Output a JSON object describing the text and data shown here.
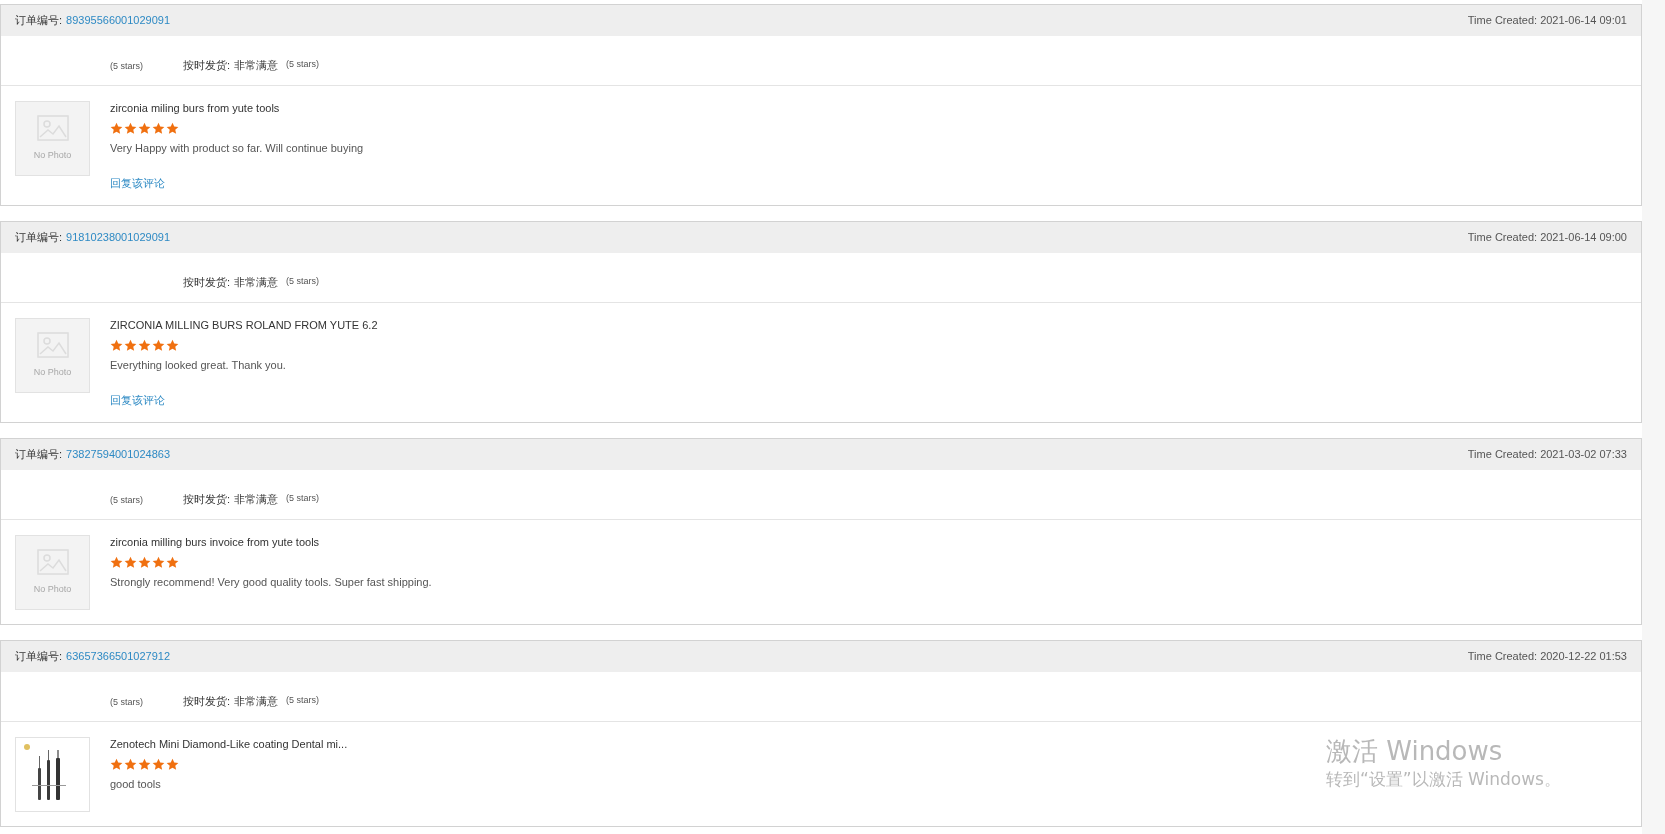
{
  "reviews": [
    {
      "order_label": "订单编号:",
      "order_no": "89395566001029091",
      "time": "Time Created: 2021-06-14 09:01",
      "service_note": "(5 stars)",
      "shipping_label": "按时发货:",
      "shipping_value": "非常满意",
      "shipping_note": "(5 stars)",
      "product": {
        "kind": "no-photo",
        "photo_text": "No Photo",
        "title": "zirconia miling burs from yute tools"
      },
      "stars": 5,
      "comment": "Very Happy with product so far.  Will continue buying",
      "reply_link": "回复该评论"
    },
    {
      "order_label": "订单编号:",
      "order_no": "91810238001029091",
      "time": "Time Created: 2021-06-14 09:00",
      "shipping_label": "按时发货:",
      "shipping_value": "非常满意",
      "shipping_note": "(5 stars)",
      "product": {
        "kind": "no-photo",
        "photo_text": "No Photo",
        "title": "ZIRCONIA MILLING BURS ROLAND FROM YUTE 6.2"
      },
      "stars": 5,
      "comment": "Everything looked great.  Thank you.",
      "reply_link": "回复该评论"
    },
    {
      "order_label": "订单编号:",
      "order_no": "73827594001024863",
      "time": "Time Created: 2021-03-02 07:33",
      "service_note": "(5 stars)",
      "shipping_label": "按时发货:",
      "shipping_value": "非常满意",
      "shipping_note": "(5 stars)",
      "product": {
        "kind": "no-photo",
        "photo_text": "No Photo",
        "title": "zirconia milling burs invoice from yute tools"
      },
      "stars": 5,
      "comment": "Strongly recommend! Very good quality tools. Super fast shipping."
    },
    {
      "order_label": "订单编号:",
      "order_no": "63657366501027912",
      "time": "Time Created: 2020-12-22 01:53",
      "service_note": "(5 stars)",
      "shipping_label": "按时发货:",
      "shipping_value": "非常满意",
      "shipping_note": "(5 stars)",
      "product": {
        "kind": "picture",
        "title": "Zenotech Mini Diamond-Like coating Dental mi..."
      },
      "stars": 5,
      "comment": "good tools"
    }
  ],
  "os_notice": {
    "title": "激活 Windows",
    "text": "转到“设置”以激活 Windows。"
  }
}
